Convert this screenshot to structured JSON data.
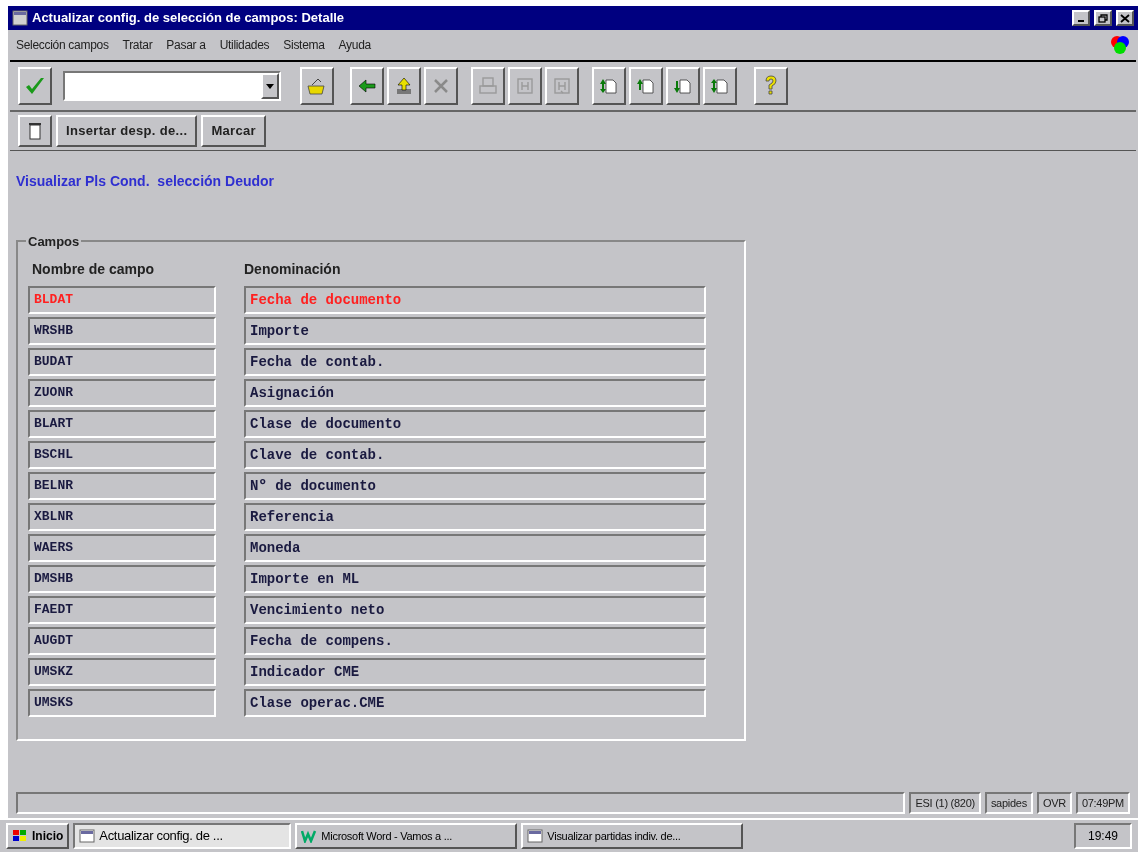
{
  "window": {
    "title": "Actualizar config. de selección de campos: Detalle"
  },
  "menu": [
    "Selección campos",
    "Tratar",
    "Pasar a",
    "Utilidades",
    "Sistema",
    "Ayuda"
  ],
  "toolbar": {
    "buttons": [
      {
        "kind": "back",
        "disabled": false
      },
      {
        "kind": "exit",
        "disabled": false
      },
      {
        "kind": "cancel",
        "disabled": true
      },
      {
        "kind": "print",
        "disabled": true
      },
      {
        "kind": "find",
        "disabled": true
      },
      {
        "kind": "find-next",
        "disabled": true
      },
      {
        "kind": "first-page",
        "disabled": false
      },
      {
        "kind": "prev-page",
        "disabled": false
      },
      {
        "kind": "next-page",
        "disabled": false
      },
      {
        "kind": "last-page",
        "disabled": false
      }
    ]
  },
  "app_toolbar": [
    "Insertar desp. de...",
    "Marcar"
  ],
  "heading": "Visualizar Pls Cond.  selección Deudor",
  "group": {
    "title": "Campos",
    "columns": [
      "Nombre de campo",
      "Denominación"
    ],
    "rows": [
      {
        "field": "BLDAT",
        "text": "Fecha de documento",
        "highlighted": true
      },
      {
        "field": "WRSHB",
        "text": "Importe",
        "highlighted": false
      },
      {
        "field": "BUDAT",
        "text": "Fecha de contab.",
        "highlighted": false
      },
      {
        "field": "ZUONR",
        "text": "Asignación",
        "highlighted": false
      },
      {
        "field": "BLART",
        "text": "Clase de documento",
        "highlighted": false
      },
      {
        "field": "BSCHL",
        "text": "Clave de contab.",
        "highlighted": false
      },
      {
        "field": "BELNR",
        "text": "Nº de documento",
        "highlighted": false
      },
      {
        "field": "XBLNR",
        "text": "Referencia",
        "highlighted": false
      },
      {
        "field": "WAERS",
        "text": "Moneda",
        "highlighted": false
      },
      {
        "field": "DMSHB",
        "text": "Importe en ML",
        "highlighted": false
      },
      {
        "field": "FAEDT",
        "text": "Vencimiento neto",
        "highlighted": false
      },
      {
        "field": "AUGDT",
        "text": "Fecha de compens.",
        "highlighted": false
      },
      {
        "field": "UMSKZ",
        "text": "Indicador CME",
        "highlighted": false
      },
      {
        "field": "UMSKS",
        "text": "Clase operac.CME",
        "highlighted": false
      }
    ]
  },
  "status_bar": [
    "ESI (1) (820)",
    "sapides",
    "OVR",
    "07:49PM"
  ],
  "taskbar": {
    "start": "Inicio",
    "tasks": [
      {
        "label": "Actualizar config. de ...",
        "selected": true
      },
      {
        "label": "Microsoft Word - Vamos a ...",
        "selected": false
      },
      {
        "label": "Visualizar partidas indiv. de...",
        "selected": false
      }
    ],
    "clock": "19:49"
  }
}
